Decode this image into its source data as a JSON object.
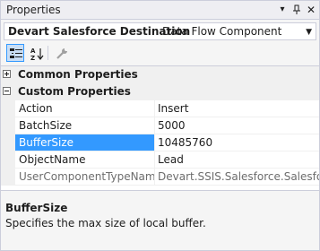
{
  "window": {
    "title": "Properties",
    "buttons": {
      "dropdown": "▾",
      "pin": "📌",
      "close": "✕"
    }
  },
  "object_selector": {
    "name": "Devart Salesforce Destination",
    "type": "Data Flow Component",
    "arrow": "▼"
  },
  "toolbar": {
    "categorized_icon": "categorized-icon",
    "alphabetical_icon": "sort-alphabetical-icon",
    "property_pages_icon": "wrench-icon"
  },
  "grid": {
    "categories": [
      {
        "label": "Common Properties",
        "expanded": false
      },
      {
        "label": "Custom Properties",
        "expanded": true
      }
    ],
    "properties": [
      {
        "name": "Action",
        "value": "Insert",
        "selected": false,
        "readonly": false
      },
      {
        "name": "BatchSize",
        "value": "5000",
        "selected": false,
        "readonly": false
      },
      {
        "name": "BufferSize",
        "value": "10485760",
        "selected": true,
        "readonly": false
      },
      {
        "name": "ObjectName",
        "value": "Lead",
        "selected": false,
        "readonly": false
      },
      {
        "name": "UserComponentTypeName",
        "value": "Devart.SSIS.Salesforce.SalesforceD",
        "selected": false,
        "readonly": true
      }
    ]
  },
  "description": {
    "title": "BufferSize",
    "text": "Specifies the max size of local buffer."
  },
  "colors": {
    "selection": "#3399ff",
    "panel": "#f5f5f5",
    "border": "#cccedb"
  }
}
